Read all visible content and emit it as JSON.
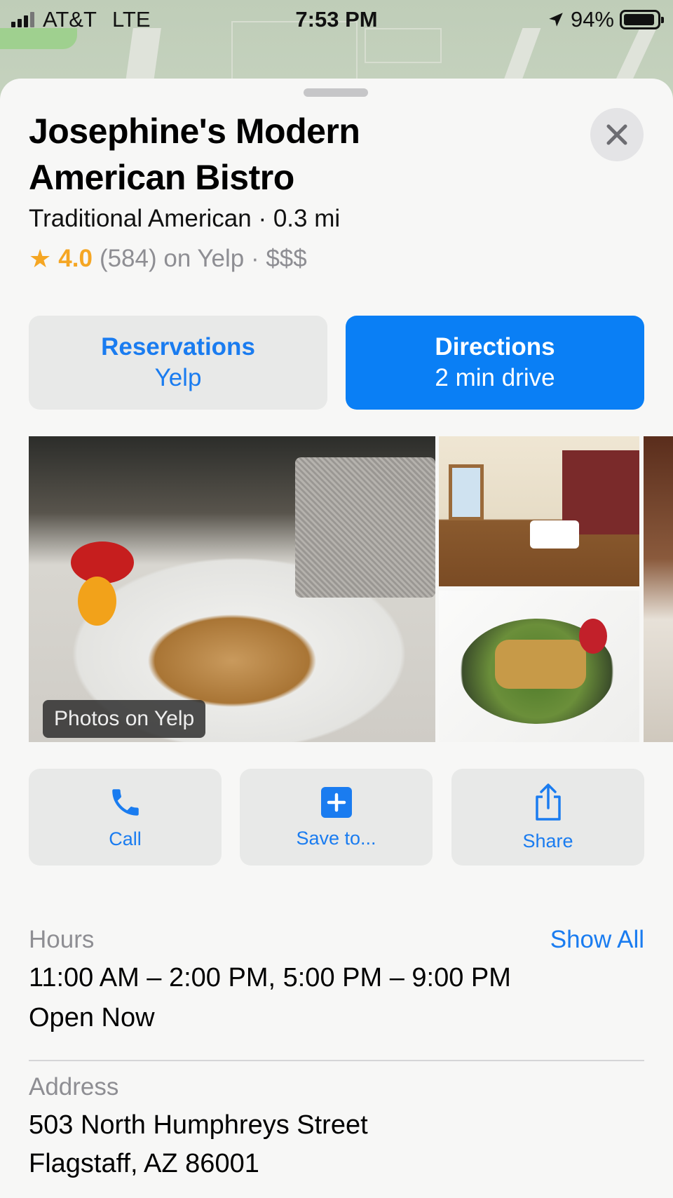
{
  "status_bar": {
    "carrier": "AT&T",
    "network": "LTE",
    "time": "7:53 PM",
    "battery": "94%",
    "battery_level": 0.94,
    "icons": [
      "signal-icon",
      "location-arrow-icon",
      "battery-icon"
    ]
  },
  "place": {
    "name": "Josephine's Modern American Bistro",
    "category": "Traditional American",
    "distance": "0.3 mi",
    "subtitle": "Traditional American · 0.3 mi",
    "rating": "4.0",
    "reviews": "(584) on Yelp · $$$"
  },
  "buttons": {
    "reservations": {
      "label": "Reservations",
      "sub": "Yelp"
    },
    "directions": {
      "label": "Directions",
      "sub": "2 min drive"
    }
  },
  "photos": {
    "label": "Photos on Yelp",
    "items": [
      "pancakes",
      "dining-room",
      "salad-dish",
      "dessert"
    ]
  },
  "actions": {
    "call": "Call",
    "save": "Save to...",
    "share": "Share"
  },
  "hours": {
    "label": "Hours",
    "show_all": "Show All",
    "value": "11:00 AM – 2:00 PM, 5:00 PM – 9:00 PM",
    "status": "Open Now"
  },
  "address": {
    "label": "Address",
    "line1": "503 North Humphreys Street",
    "line2": "Flagstaff, AZ 86001"
  },
  "colors": {
    "accent": "#0a7ff5",
    "link": "#1a7cf0",
    "star": "#f5a623",
    "secondary_text": "#8e8e93",
    "sheet_bg": "#f7f7f6",
    "button_bg": "#e8e9e8"
  }
}
